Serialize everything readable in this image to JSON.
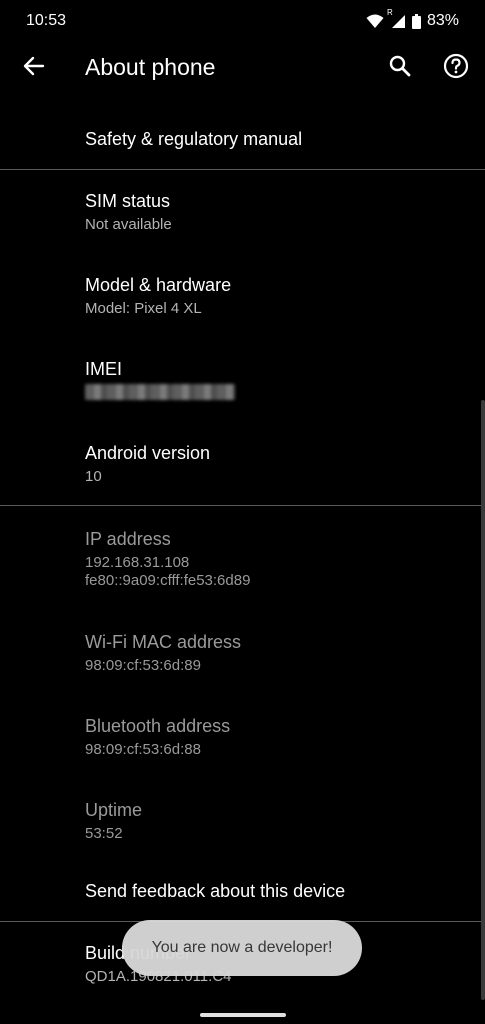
{
  "status_bar": {
    "time": "10:53",
    "network_badge": "R",
    "battery": "83%",
    "icons": [
      "wifi-icon",
      "signal-icon",
      "battery-icon"
    ]
  },
  "app_bar": {
    "title": "About phone",
    "icons": [
      "back-arrow-icon",
      "search-icon",
      "help-icon"
    ]
  },
  "items": {
    "safety": {
      "title": "Safety & regulatory manual"
    },
    "sim": {
      "title": "SIM status",
      "summary": "Not available"
    },
    "model": {
      "title": "Model & hardware",
      "summary": "Model: Pixel 4 XL"
    },
    "imei": {
      "title": "IMEI"
    },
    "android": {
      "title": "Android version",
      "summary": "10"
    },
    "ip": {
      "title": "IP address",
      "line1": "192.168.31.108",
      "line2": "fe80::9a09:cfff:fe53:6d89"
    },
    "wifi_mac": {
      "title": "Wi-Fi MAC address",
      "summary": "98:09:cf:53:6d:89"
    },
    "bt": {
      "title": "Bluetooth address",
      "summary": "98:09:cf:53:6d:88"
    },
    "uptime": {
      "title": "Uptime",
      "summary": "53:52"
    },
    "feedback": {
      "title": "Send feedback about this device"
    },
    "build": {
      "title": "Build number",
      "summary": "QD1A.190821.011.C4"
    }
  },
  "toast": {
    "message": "You are now a developer!"
  },
  "colors": {
    "background": "#000000",
    "primary_text": "#ffffff",
    "secondary_text": "#b4b4b4",
    "disabled_text": "#9a9a9a",
    "divider": "#5a5a5a",
    "toast_bg": "#d8d8d8"
  }
}
